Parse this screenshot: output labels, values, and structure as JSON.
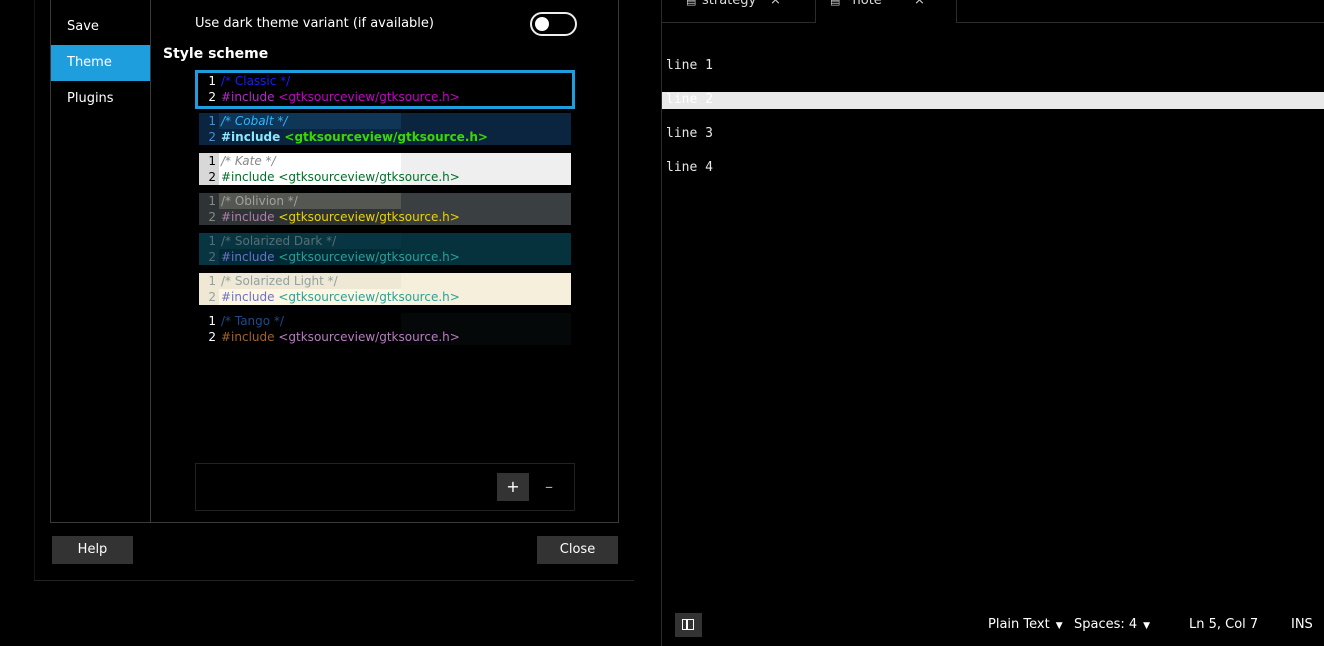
{
  "prefs": {
    "sidebar": {
      "items": [
        {
          "label": "Save",
          "selected": false
        },
        {
          "label": "Theme",
          "selected": true
        },
        {
          "label": "Plugins",
          "selected": false
        }
      ]
    },
    "dark_theme_label": "Use dark theme variant (if available)",
    "dark_theme_on": false,
    "style_scheme_title": "Style scheme",
    "schemes": [
      {
        "comment": "/* Classic */",
        "include": "#include",
        "header": "<gtksourceview/gtksource.h>",
        "selected": true
      },
      {
        "comment": "/* Cobalt */",
        "include": "#include",
        "header": "<gtksourceview/gtksource.h>"
      },
      {
        "comment": "/* Kate */",
        "include": "#include",
        "header": "<gtksourceview/gtksource.h>"
      },
      {
        "comment": "/* Oblivion */",
        "include": "#include",
        "header": "<gtksourceview/gtksource.h>"
      },
      {
        "comment": "/* Solarized Dark */",
        "include": "#include",
        "header": "<gtksourceview/gtksource.h>"
      },
      {
        "comment": "/* Solarized Light */",
        "include": "#include",
        "header": "<gtksourceview/gtksource.h>"
      },
      {
        "comment": "/* Tango */",
        "include": "#include",
        "header": "<gtksourceview/gtksource.h>"
      }
    ],
    "line_numbers": [
      "1",
      "2"
    ],
    "add_label": "+",
    "remove_label": "–",
    "help_label": "Help",
    "close_label": "Close",
    "accent_color": "#1f9ede"
  },
  "editor": {
    "tabs": [
      {
        "label": "strategy",
        "close": "×"
      },
      {
        "label": "*note",
        "close": "×",
        "active": true
      }
    ],
    "lines": [
      "line 1",
      "line 2",
      "line 3",
      "line 4"
    ],
    "current_line": 2,
    "status": {
      "language": "Plain Text",
      "spaces": "Spaces: 4",
      "position": "Ln 5, Col 7",
      "mode": "INS"
    }
  }
}
